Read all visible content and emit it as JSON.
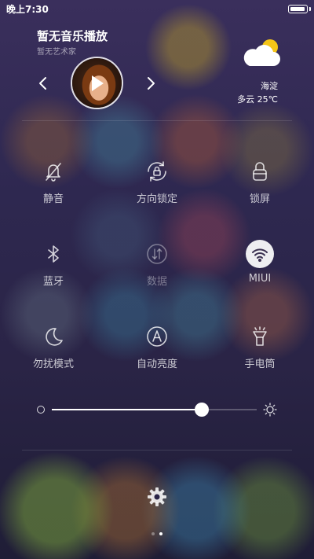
{
  "status_bar": {
    "time": "晚上7:30",
    "battery_level": 1.0
  },
  "music": {
    "title": "暂无音乐播放",
    "artist": "暂无艺术家",
    "album_art_icon": "album-art-woman-headphones",
    "prev_icon": "chevron-left-icon",
    "next_icon": "chevron-right-icon",
    "play_icon": "play-icon"
  },
  "weather": {
    "icon": "partly-cloudy-icon",
    "city": "海淀",
    "description": "多云 25℃"
  },
  "toggles": [
    {
      "label": "静音",
      "icon": "bell-off-icon",
      "active": false,
      "enabled": true
    },
    {
      "label": "方向锁定",
      "icon": "rotation-lock-icon",
      "active": false,
      "enabled": true
    },
    {
      "label": "锁屏",
      "icon": "lock-icon",
      "active": false,
      "enabled": true
    },
    {
      "label": "蓝牙",
      "icon": "bluetooth-icon",
      "active": false,
      "enabled": true
    },
    {
      "label": "数据",
      "icon": "data-arrows-icon",
      "active": false,
      "enabled": false
    },
    {
      "label": "MIUI",
      "icon": "wifi-icon",
      "active": true,
      "enabled": true
    },
    {
      "label": "勿扰模式",
      "icon": "moon-icon",
      "active": false,
      "enabled": true
    },
    {
      "label": "自动亮度",
      "icon": "auto-brightness-icon",
      "active": false,
      "enabled": true
    },
    {
      "label": "手电筒",
      "icon": "flashlight-icon",
      "active": false,
      "enabled": true
    }
  ],
  "brightness": {
    "level": 0.73,
    "low_icon": "brightness-low-icon",
    "high_icon": "sun-icon"
  },
  "settings": {
    "icon": "gear-icon"
  },
  "pagination": {
    "total": 2,
    "current": 2
  },
  "colors": {
    "background": "#2a2548",
    "active_toggle_bg": "#ffffff",
    "active_toggle_icon": "#3a3050"
  }
}
